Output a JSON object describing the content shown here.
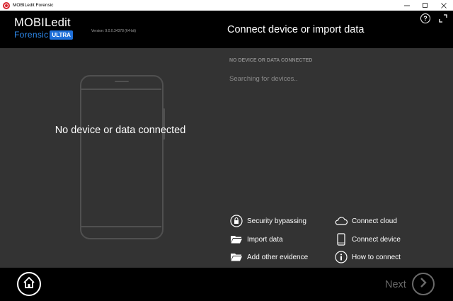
{
  "window": {
    "title": "MOBILedit Forensic",
    "controls": [
      "minimize-icon",
      "maximize-icon",
      "close-icon"
    ]
  },
  "brand": {
    "name": "MOBILedit",
    "product": "Forensic",
    "badge": "ULTRA",
    "version": "Version: 9.0.0.34378 (64-bit)"
  },
  "header": {
    "title": "Connect device or import data",
    "help_label": "?"
  },
  "device_panel": {
    "placeholder_text": "No device or data connected"
  },
  "status": {
    "heading": "NO DEVICE OR DATA CONNECTED",
    "message": "Searching for devices.."
  },
  "actions": {
    "security_bypassing": "Security bypassing",
    "import_data": "Import data",
    "add_other_evidence": "Add other evidence",
    "connect_cloud": "Connect cloud",
    "connect_device": "Connect device",
    "how_to_connect": "How to connect"
  },
  "footer": {
    "next_label": "Next"
  },
  "colors": {
    "accent_blue": "#2f8cf0",
    "badge_blue": "#1e6fd9",
    "header_bg": "#000000",
    "main_bg": "#333333",
    "muted_text": "#8a8a8a",
    "disabled": "#6a6a6a"
  }
}
